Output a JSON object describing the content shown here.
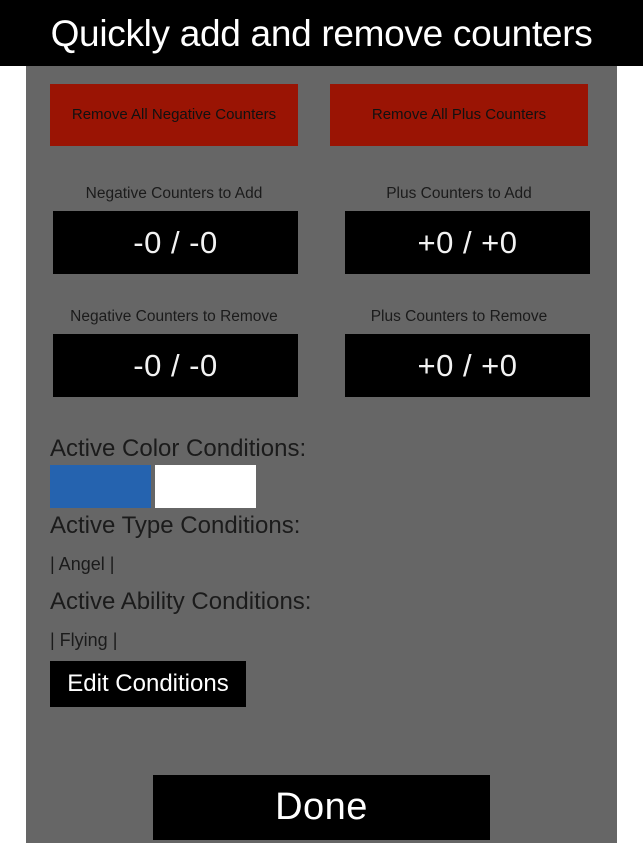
{
  "window": {
    "title": "Quickly add and remove counters"
  },
  "colors": {
    "panel_background": "#666666",
    "titlebar_background": "#000000",
    "danger_button": "#9a1404",
    "field_background": "#000000",
    "field_text": "#f2f2f2",
    "body_text": "#1b1b1b"
  },
  "actions": {
    "remove_all_negative": "Remove All Negative Counters",
    "remove_all_plus": "Remove All Plus Counters",
    "edit_conditions": "Edit Conditions",
    "done": "Done"
  },
  "counters": [
    {
      "label": "Negative Counters to Add",
      "value": "-0 / -0"
    },
    {
      "label": "Plus Counters to Add",
      "value": "+0 / +0"
    },
    {
      "label": "Negative Counters to Remove",
      "value": "-0 / -0"
    },
    {
      "label": "Plus Counters to Remove",
      "value": "+0 / +0"
    }
  ],
  "conditions": {
    "color": {
      "heading": "Active Color Conditions:",
      "swatches": [
        {
          "name": "blue",
          "hex": "#2563af"
        },
        {
          "name": "white",
          "hex": "#ffffff"
        }
      ]
    },
    "type": {
      "heading": "Active Type Conditions:",
      "values": "| Angel |"
    },
    "ability": {
      "heading": "Active Ability Conditions:",
      "values": "| Flying |"
    }
  }
}
